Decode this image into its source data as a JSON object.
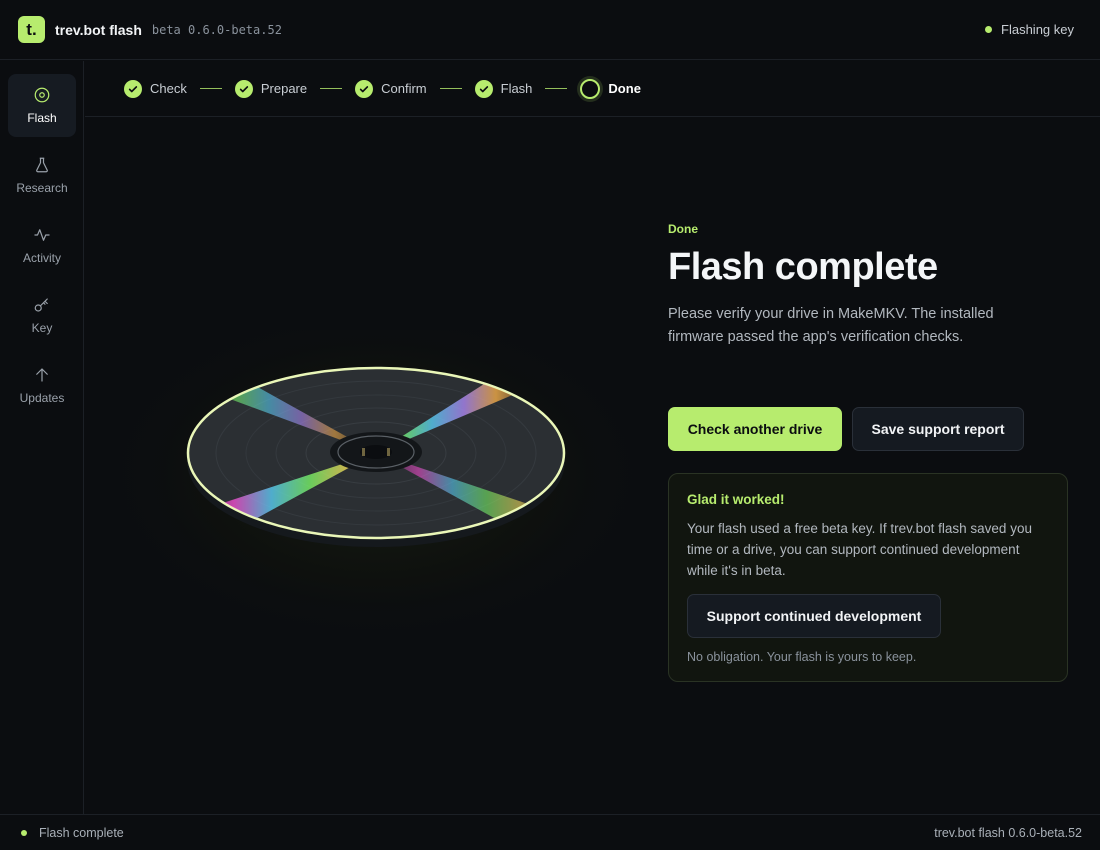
{
  "titlebar": {
    "logo": "t.",
    "app_name": "trev.bot flash",
    "version": "beta 0.6.0-beta.52",
    "status": "Flashing key"
  },
  "sidebar": {
    "items": [
      {
        "label": "Flash",
        "icon": "disc-icon",
        "active": true
      },
      {
        "label": "Research",
        "icon": "flask-icon",
        "active": false
      },
      {
        "label": "Activity",
        "icon": "activity-icon",
        "active": false
      },
      {
        "label": "Key",
        "icon": "key-icon",
        "active": false
      },
      {
        "label": "Updates",
        "icon": "arrow-up-icon",
        "active": false
      }
    ]
  },
  "stepper": {
    "steps": [
      {
        "label": "Check",
        "state": "done"
      },
      {
        "label": "Prepare",
        "state": "done"
      },
      {
        "label": "Confirm",
        "state": "done"
      },
      {
        "label": "Flash",
        "state": "done"
      },
      {
        "label": "Done",
        "state": "current"
      }
    ]
  },
  "main": {
    "eyebrow": "Done",
    "headline": "Flash complete",
    "description": "Please verify your drive in MakeMKV. The installed firmware passed the app's verification checks.",
    "primary_button": "Check another drive",
    "secondary_button": "Save support report",
    "card": {
      "title": "Glad it worked!",
      "body": "Your flash used a free beta key. If trev.bot flash saved you time or a drive, you can support continued development while it's in beta.",
      "button": "Support continued development",
      "note": "No obligation. Your flash is yours to keep."
    }
  },
  "statusbar": {
    "left": "Flash complete",
    "right": "trev.bot flash 0.6.0-beta.52"
  },
  "colors": {
    "accent": "#b7ec6e",
    "background": "#0b0d10",
    "panel": "#151a21"
  }
}
